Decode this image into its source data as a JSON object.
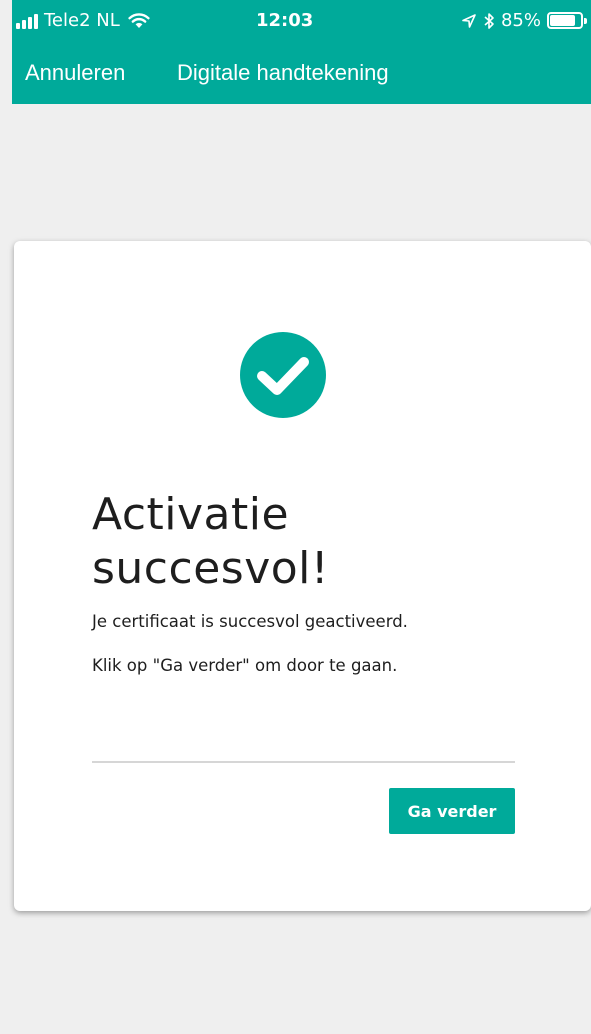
{
  "colors": {
    "brand": "#00aa9a",
    "background": "#efefef",
    "card": "#ffffff",
    "text": "#1e1e1e",
    "divider": "#d6d6d6"
  },
  "status_bar": {
    "carrier": "Tele2 NL",
    "time": "12:03",
    "battery_percent": "85%",
    "battery_level": 0.85,
    "icons": [
      "signal-icon",
      "wifi-icon",
      "location-icon",
      "bluetooth-icon",
      "battery-icon"
    ]
  },
  "nav": {
    "cancel_label": "Annuleren",
    "title": "Digitale handtekening"
  },
  "card": {
    "icon": "check-circle-icon",
    "title": "Activatie succesvol!",
    "message_1": "Je certificaat is succesvol geactiveerd.",
    "message_2": "Klik op \"Ga verder\" om door te gaan.",
    "continue_label": "Ga verder"
  }
}
